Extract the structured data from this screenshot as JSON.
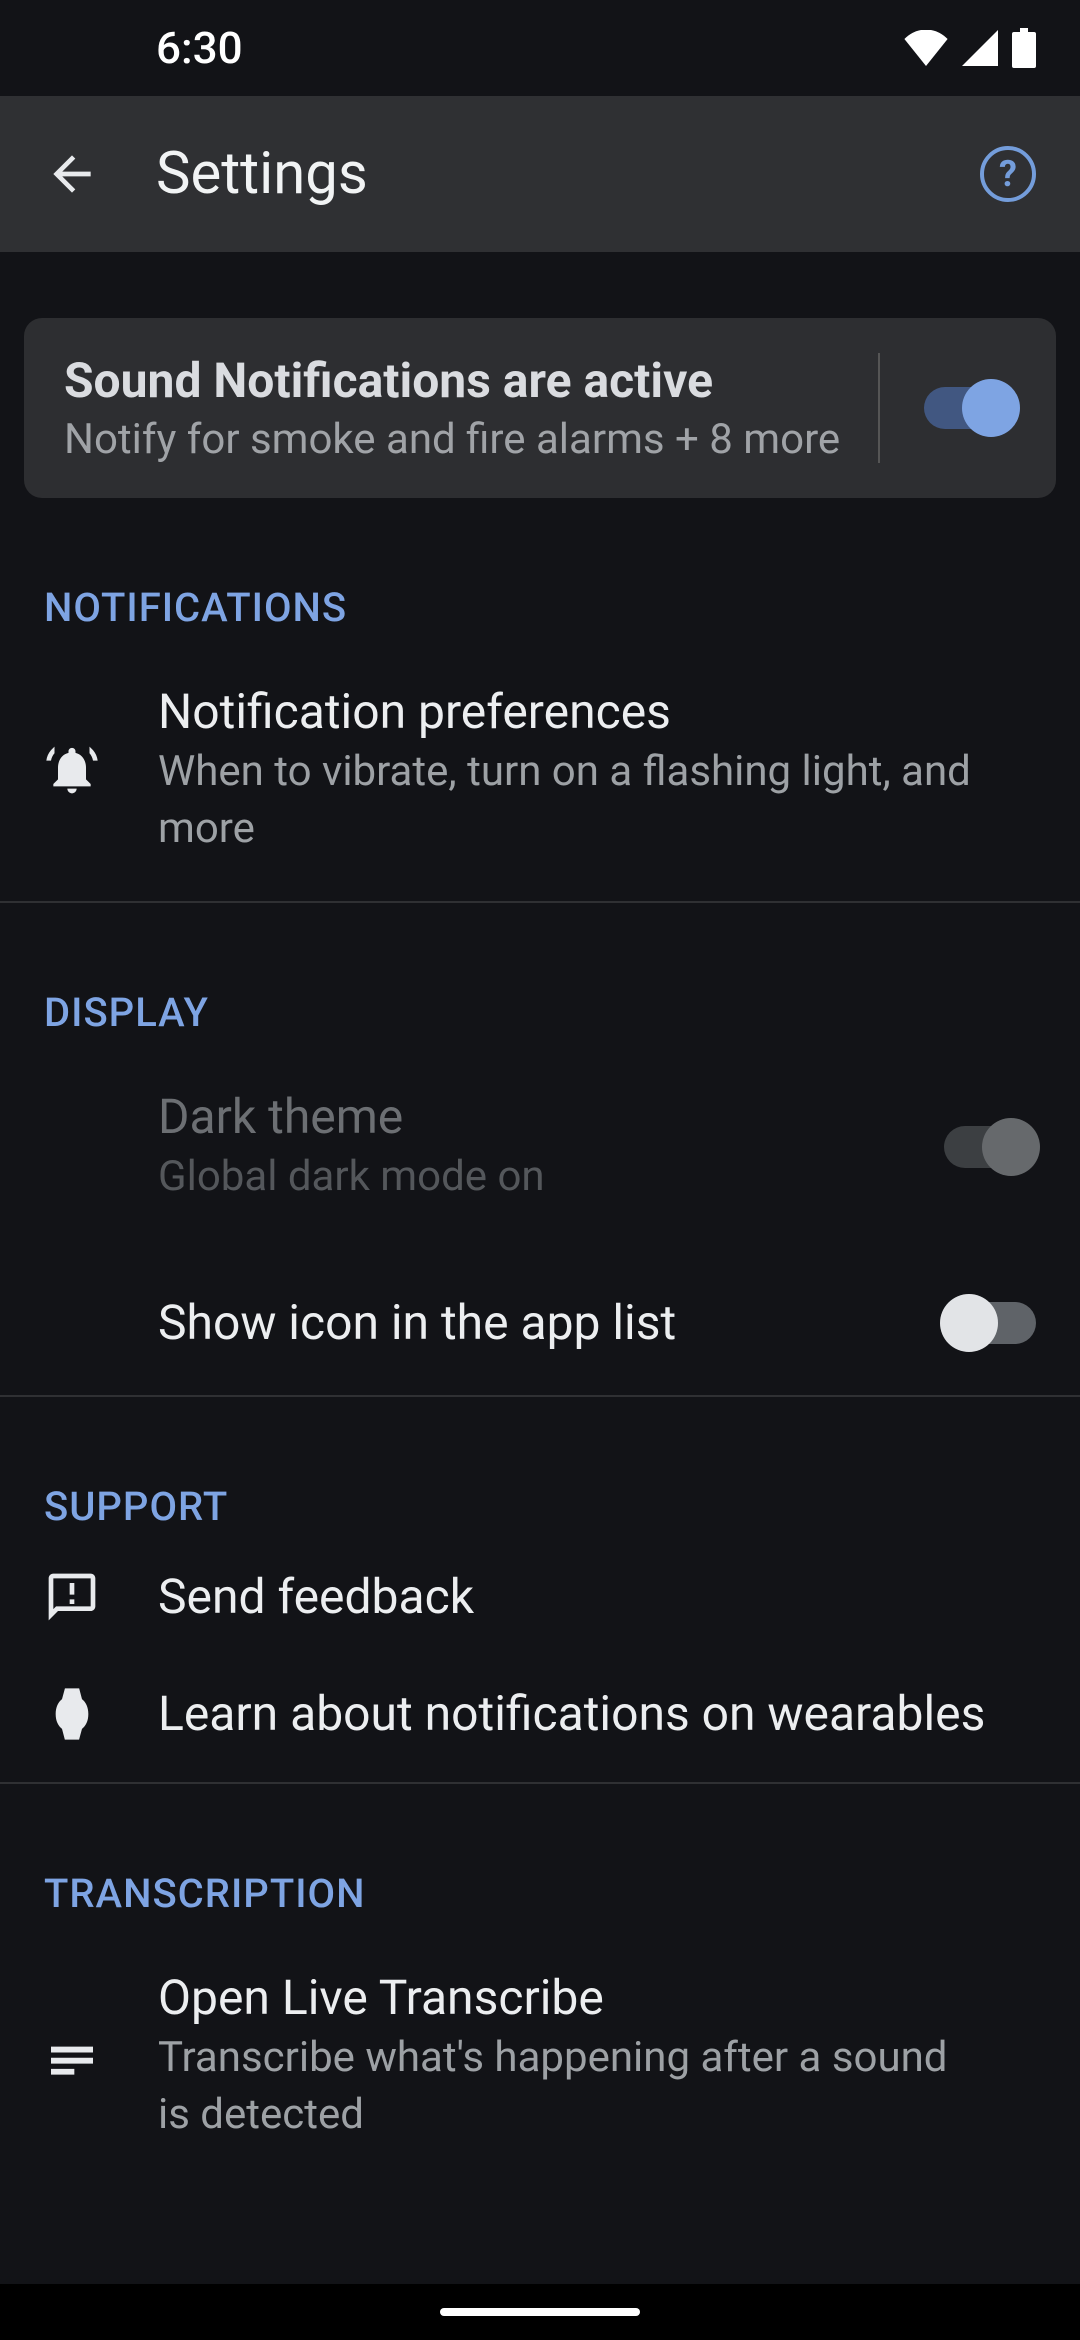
{
  "status": {
    "time": "6:30"
  },
  "appbar": {
    "title": "Settings"
  },
  "banner": {
    "title": "Sound Notifications are active",
    "subtitle": "Notify for smoke and fire alarms + 8 more",
    "toggle_on": true
  },
  "sections": {
    "notifications": {
      "header": "NOTIFICATIONS",
      "pref": {
        "title": "Notification preferences",
        "subtitle": "When to vibrate, turn on a flashing light, and more"
      }
    },
    "display": {
      "header": "DISPLAY",
      "dark": {
        "title": "Dark theme",
        "subtitle": "Global dark mode on"
      },
      "showicon": {
        "title": "Show icon in the app list"
      }
    },
    "support": {
      "header": "SUPPORT",
      "feedback": {
        "title": "Send feedback"
      },
      "wearables": {
        "title": "Learn about notifications on wearables"
      }
    },
    "transcription": {
      "header": "TRANSCRIPTION",
      "live": {
        "title": "Open Live Transcribe",
        "subtitle": "Transcribe what's happening after a sound is detected"
      }
    }
  }
}
